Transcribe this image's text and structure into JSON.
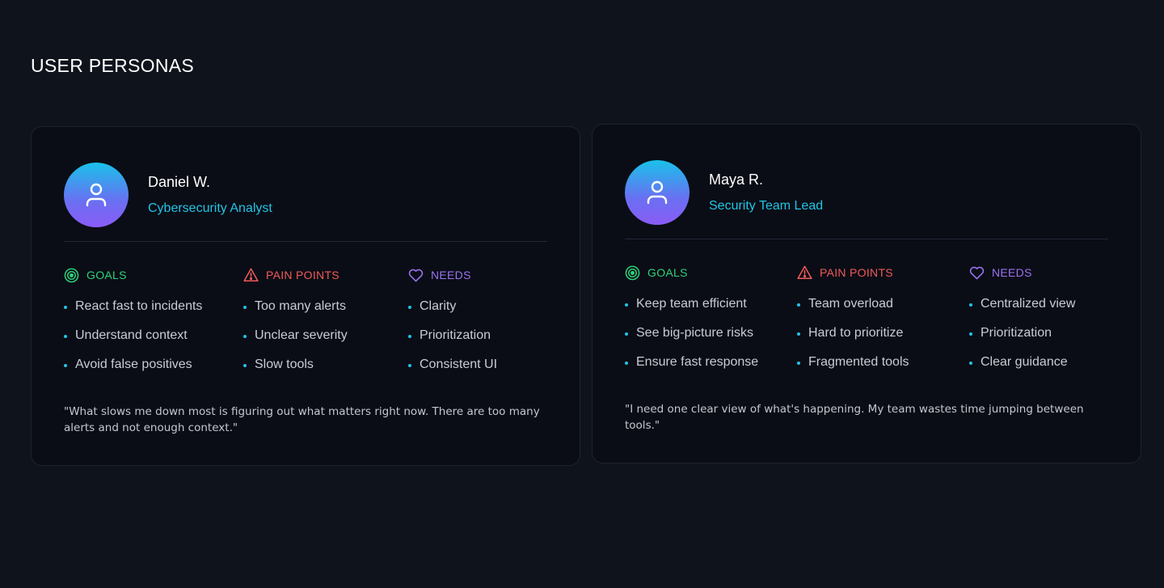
{
  "page": {
    "title": "USER PERSONAS"
  },
  "colors": {
    "background": "#0f131c",
    "card": "#0a0d15",
    "accent_cyan": "#22c3e6",
    "goals": "#2fd07a",
    "pain": "#f05a5a",
    "needs": "#9a72f2"
  },
  "personas": [
    {
      "name": "Daniel W.",
      "role": "Cybersecurity Analyst",
      "avatar_icon": "user-icon",
      "goals": {
        "label": "GOALS",
        "icon": "target-icon",
        "items": [
          "React fast to incidents",
          "Understand context",
          "Avoid false positives"
        ]
      },
      "pains": {
        "label": "PAIN POINTS",
        "icon": "warning-icon",
        "items": [
          "Too many alerts",
          "Unclear severity",
          "Slow tools"
        ]
      },
      "needs": {
        "label": "NEEDS",
        "icon": "heart-icon",
        "items": [
          "Clarity",
          "Prioritization",
          "Consistent UI"
        ]
      },
      "quote": "\"What slows me down most is figuring out what matters right now. There are too many alerts and not enough context.\""
    },
    {
      "name": "Maya R.",
      "role": "Security Team Lead",
      "avatar_icon": "user-icon",
      "goals": {
        "label": "GOALS",
        "icon": "target-icon",
        "items": [
          "Keep team efficient",
          "See big-picture risks",
          "Ensure fast response"
        ]
      },
      "pains": {
        "label": "PAIN POINTS",
        "icon": "warning-icon",
        "items": [
          "Team overload",
          "Hard to prioritize",
          "Fragmented tools"
        ]
      },
      "needs": {
        "label": "NEEDS",
        "icon": "heart-icon",
        "items": [
          "Centralized view",
          "Prioritization",
          "Clear guidance"
        ]
      },
      "quote": "\"I need one clear view of what's happening. My team wastes time jumping between tools.\""
    }
  ]
}
